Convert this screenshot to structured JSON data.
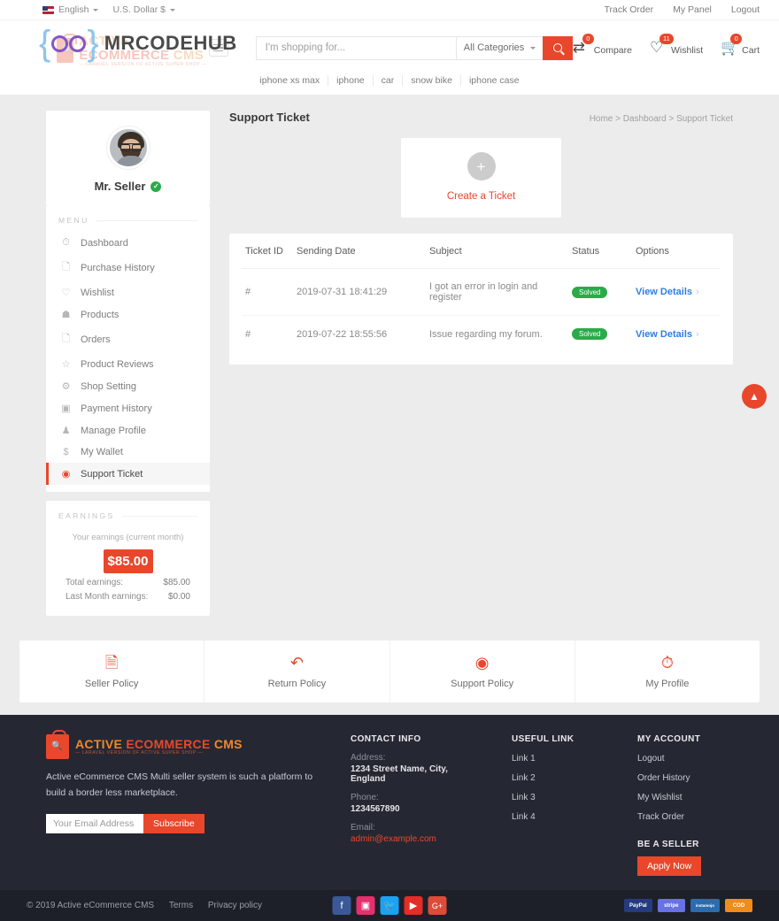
{
  "topbar": {
    "language": "English",
    "currency": "U.S. Dollar $",
    "links": [
      "Track Order",
      "My Panel",
      "Logout"
    ]
  },
  "header": {
    "watermark_text": "MRCODEHUB",
    "logo_part1": "ACTIVE",
    "logo_part2": "ECOMMERCE",
    "logo_part3": "CMS",
    "logo_tagline": "— LARAVEL VERSION OF ACTIVE SUPER SHOP —",
    "search_placeholder": "I'm shopping for...",
    "search_value": "",
    "category_selected": "All Categories",
    "actions": [
      {
        "name": "Compare",
        "count": "0",
        "icon": "compare-icon"
      },
      {
        "name": "Wishlist",
        "count": "11",
        "icon": "heart-icon"
      },
      {
        "name": "Cart",
        "count": "0",
        "icon": "cart-icon"
      }
    ],
    "keywords": [
      "iphone xs max",
      "iphone",
      "car",
      "snow bike",
      "iphone case"
    ]
  },
  "sidebar": {
    "seller_name": "Mr. Seller",
    "menu_header": "MENU",
    "items": [
      {
        "label": "Dashboard",
        "icon": "speedometer-icon",
        "active": false
      },
      {
        "label": "Purchase History",
        "icon": "receipt-icon",
        "active": false
      },
      {
        "label": "Wishlist",
        "icon": "heart-icon",
        "active": false
      },
      {
        "label": "Products",
        "icon": "tag-icon",
        "active": false
      },
      {
        "label": "Orders",
        "icon": "list-icon",
        "active": false
      },
      {
        "label": "Product Reviews",
        "icon": "star-icon",
        "active": false
      },
      {
        "label": "Shop Setting",
        "icon": "gear-icon",
        "active": false
      },
      {
        "label": "Payment History",
        "icon": "card-icon",
        "active": false
      },
      {
        "label": "Manage Profile",
        "icon": "user-icon",
        "active": false
      },
      {
        "label": "My Wallet",
        "icon": "dollar-icon",
        "active": false
      },
      {
        "label": "Support Ticket",
        "icon": "lifebuoy-icon",
        "active": true
      }
    ],
    "earnings_header": "EARNINGS",
    "earnings_subtitle": "Your earnings (current month)",
    "earnings_amount": "$85.00",
    "total_earnings_label": "Total earnings:",
    "total_earnings_value": "$85.00",
    "last_month_label": "Last Month earnings:",
    "last_month_value": "$0.00"
  },
  "main": {
    "page_title": "Support Ticket",
    "breadcrumb": "Home > Dashboard > Support Ticket",
    "create_ticket_label": "Create a Ticket",
    "create_ticket_icon": "plus-icon",
    "table": {
      "headers": [
        "Ticket ID",
        "Sending Date",
        "Subject",
        "Status",
        "Options"
      ],
      "rows": [
        {
          "id": "#",
          "date": "2019-07-31 18:41:29",
          "subject": "I got an error in login and register",
          "status": "Solved",
          "option": "View Details"
        },
        {
          "id": "#",
          "date": "2019-07-22 18:55:56",
          "subject": "Issue regarding my forum.",
          "status": "Solved",
          "option": "View Details"
        }
      ]
    }
  },
  "policies": [
    {
      "label": "Seller Policy",
      "icon": "document-icon"
    },
    {
      "label": "Return Policy",
      "icon": "return-arrow-icon"
    },
    {
      "label": "Support Policy",
      "icon": "lifebuoy-icon"
    },
    {
      "label": "My Profile",
      "icon": "clock-icon"
    }
  ],
  "footer": {
    "about_text": "Active eCommerce CMS Multi seller system is such a platform to build a border less marketplace.",
    "email_placeholder": "Your Email Address",
    "email_value": "",
    "subscribe_label": "Subscribe",
    "contact_title": "CONTACT INFO",
    "address_label": "Address:",
    "address_value": "1234 Street Name, City, England",
    "phone_label": "Phone:",
    "phone_value": "1234567890",
    "email_label": "Email:",
    "email_address": "admin@example.com",
    "useful_title": "USEFUL LINK",
    "useful_links": [
      "Link 1",
      "Link 2",
      "Link 3",
      "Link 4"
    ],
    "account_title": "MY ACCOUNT",
    "account_links": [
      "Logout",
      "Order History",
      "My Wishlist",
      "Track Order"
    ],
    "be_seller_title": "BE A SELLER",
    "apply_label": "Apply Now"
  },
  "bottombar": {
    "copyright": "© 2019 Active eCommerce CMS",
    "terms": "Terms",
    "privacy": "Privacy policy",
    "socials": [
      {
        "name": "facebook",
        "glyph": "f",
        "color": "#3b5998"
      },
      {
        "name": "instagram",
        "glyph": "◉",
        "color": "#e4306c"
      },
      {
        "name": "twitter",
        "glyph": "t",
        "color": "#1da1f2"
      },
      {
        "name": "youtube",
        "glyph": "▶",
        "color": "#e52d27"
      },
      {
        "name": "googleplus",
        "glyph": "G+",
        "color": "#dd4b39"
      }
    ],
    "payments": [
      {
        "name": "PayPal",
        "label": "PayPal",
        "color": "#253b80"
      },
      {
        "name": "Stripe",
        "label": "stripe",
        "color": "#6772e5"
      },
      {
        "name": "Instamojo",
        "label": "instamojo",
        "color": "#2b6cb0"
      },
      {
        "name": "Cash on Delivery",
        "label": "COD",
        "color": "#ef8c1c"
      }
    ]
  },
  "colors": {
    "accent": "#e8472b",
    "status_green": "#2aab4a",
    "link_blue": "#2f7fe0",
    "footer_dark": "#252833",
    "bottom_dark": "#1e2029"
  }
}
